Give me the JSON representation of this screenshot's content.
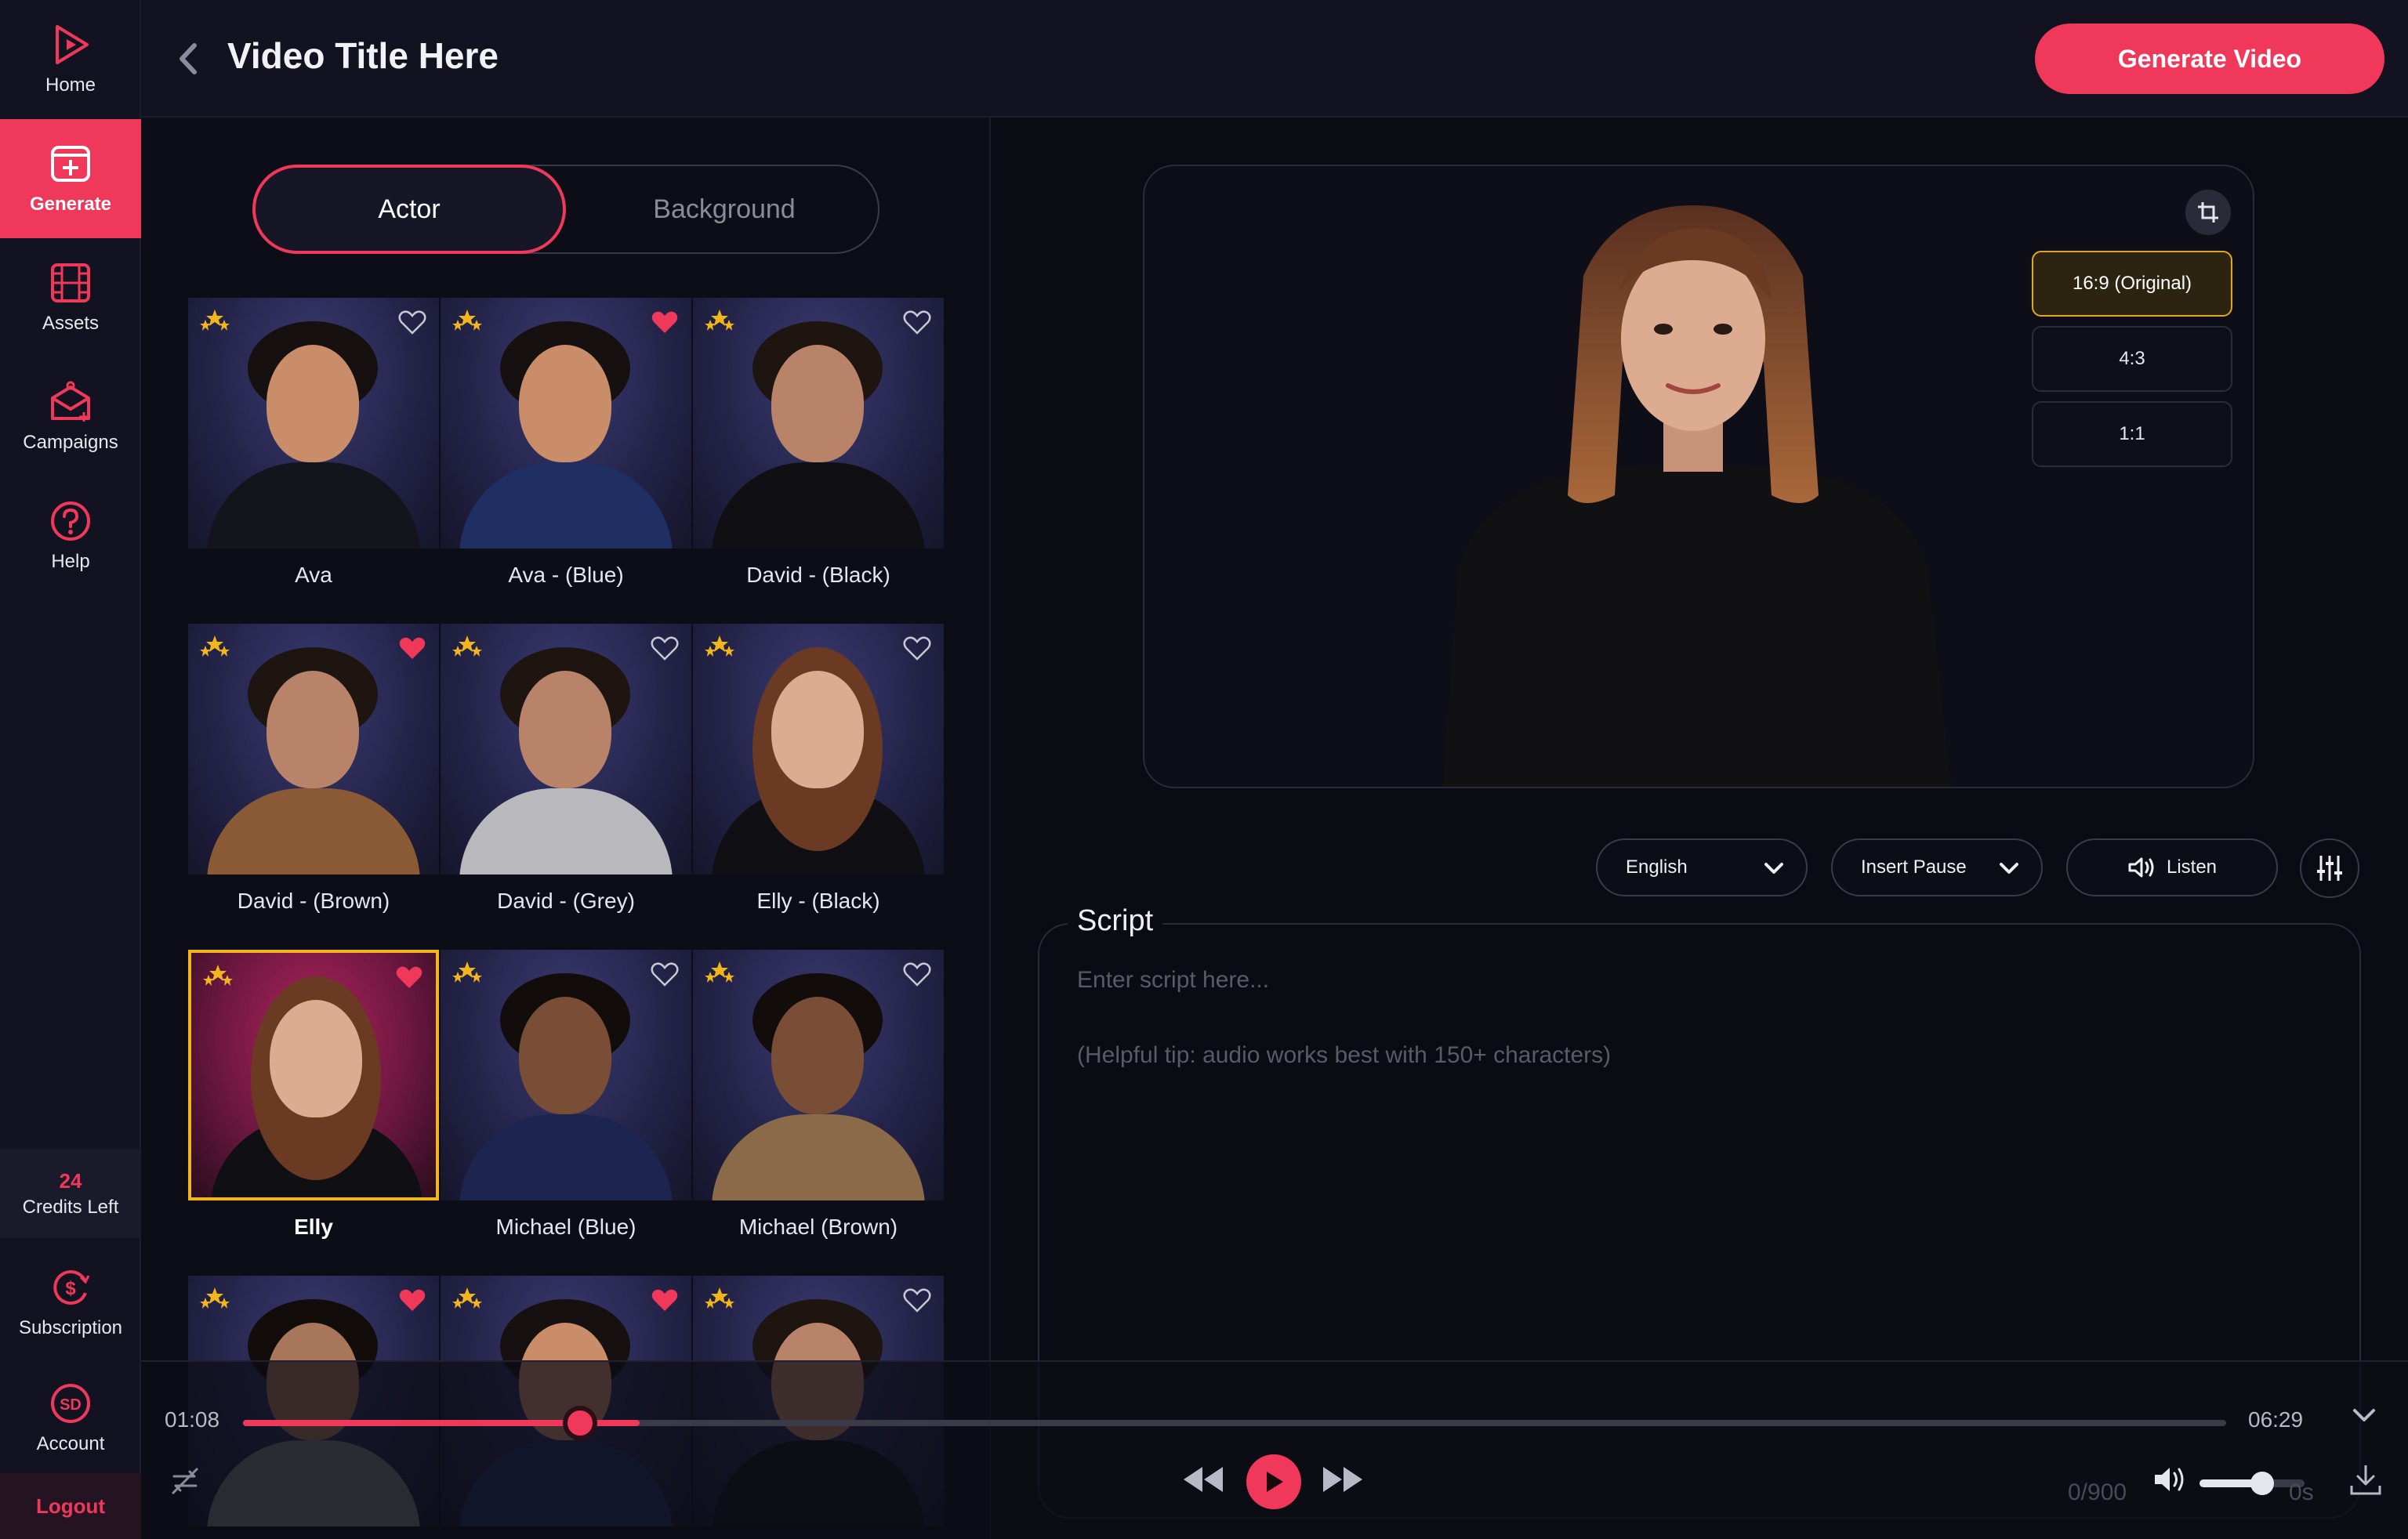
{
  "sidebar": {
    "items": [
      {
        "label": "Home",
        "icon": "play-logo-icon"
      },
      {
        "label": "Generate",
        "icon": "add-video-icon",
        "active": true
      },
      {
        "label": "Assets",
        "icon": "film-icon"
      },
      {
        "label": "Campaigns",
        "icon": "campaign-icon"
      },
      {
        "label": "Help",
        "icon": "help-icon"
      }
    ],
    "credits": {
      "count": "24",
      "label": "Credits Left"
    },
    "bottom": [
      {
        "label": "Subscription",
        "icon": "dollar-cycle-icon"
      },
      {
        "label": "Account",
        "icon": "avatar-icon",
        "initials": "SD"
      }
    ],
    "logout": "Logout"
  },
  "header": {
    "title": "Video Title Here",
    "generate_button": "Generate Video"
  },
  "tabs": {
    "actor": "Actor",
    "background": "Background",
    "active": "Actor"
  },
  "actors": [
    {
      "name": "Ava",
      "favorite": false,
      "selected": false
    },
    {
      "name": "Ava - (Blue)",
      "favorite": true,
      "selected": false
    },
    {
      "name": "David - (Black)",
      "favorite": false,
      "selected": false
    },
    {
      "name": "David - (Brown)",
      "favorite": true,
      "selected": false
    },
    {
      "name": "David - (Grey)",
      "favorite": false,
      "selected": false
    },
    {
      "name": "Elly - (Black)",
      "favorite": false,
      "selected": false
    },
    {
      "name": "Elly",
      "favorite": true,
      "selected": true
    },
    {
      "name": "Michael (Blue)",
      "favorite": false,
      "selected": false
    },
    {
      "name": "Michael (Brown)",
      "favorite": false,
      "selected": false
    },
    {
      "name": "",
      "favorite": true,
      "selected": false
    },
    {
      "name": "",
      "favorite": true,
      "selected": false
    },
    {
      "name": "",
      "favorite": false,
      "selected": false
    }
  ],
  "preview": {
    "ratios": [
      "16:9 (Original)",
      "4:3",
      "1:1"
    ],
    "active_ratio": "16:9 (Original)"
  },
  "controls": {
    "language": "English",
    "insert_pause": "Insert Pause",
    "listen": "Listen"
  },
  "script": {
    "label": "Script",
    "placeholder": "Enter script here...",
    "tip": "(Helpful tip: audio works best with 150+ characters)",
    "counter": "0/900",
    "seconds": "0s"
  },
  "player": {
    "current": "01:08",
    "duration": "06:29",
    "progress": 0.17,
    "buffered": 0.2,
    "volume": 0.6
  },
  "colors": {
    "accent": "#f0385a",
    "selected_border": "#f3b51b",
    "background": "#0b0b14"
  }
}
